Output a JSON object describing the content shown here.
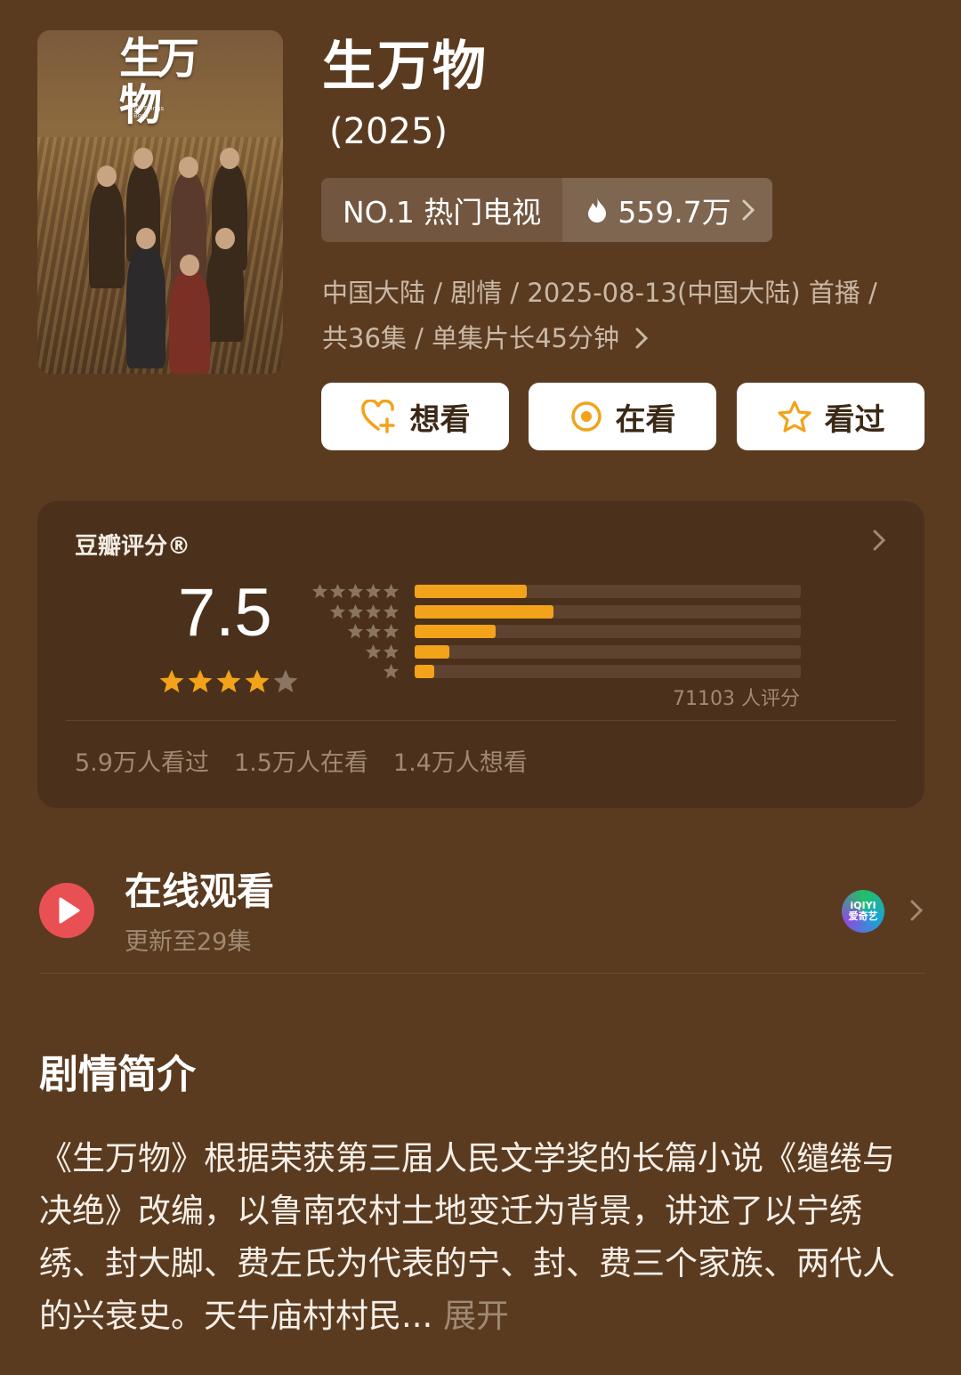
{
  "poster": {
    "logo_text": "生万物",
    "logo_sub": "All Things Born"
  },
  "title": "生万物",
  "year": "(2025)",
  "rank": {
    "label": "NO.1 热门电视",
    "heat": "559.7万"
  },
  "meta": {
    "line1": "中国大陆 / 剧情 / 2025-08-13(中国大陆) 首播 /",
    "line2": "共36集 / 单集片长45分钟"
  },
  "actions": [
    {
      "label": "想看",
      "icon": "heart-plus-icon"
    },
    {
      "label": "在看",
      "icon": "target-icon"
    },
    {
      "label": "看过",
      "icon": "star-outline-icon"
    }
  ],
  "rating": {
    "heading": "豆瓣评分®",
    "score": "7.5",
    "stars": 4,
    "distribution": [
      {
        "stars": 5,
        "fraction": 0.29
      },
      {
        "stars": 4,
        "fraction": 0.36
      },
      {
        "stars": 3,
        "fraction": 0.21
      },
      {
        "stars": 2,
        "fraction": 0.09
      },
      {
        "stars": 1,
        "fraction": 0.05
      }
    ],
    "raters": "71103 人评分",
    "counts": [
      "5.9万人看过",
      "1.5万人在看",
      "1.4万人想看"
    ]
  },
  "online": {
    "title": "在线观看",
    "subtitle": "更新至29集",
    "platform_text_top": "iQIYI",
    "platform_text_bottom": "爱奇艺"
  },
  "synopsis": {
    "title": "剧情简介",
    "text": "《生万物》根据荣获第三届人民文学奖的长篇小说《缱绻与决绝》改编，以鲁南农村土地变迁为背景，讲述了以宁绣绣、封大脚、费左氏为代表的宁、封、费三个家族、两代人的兴衰史。天牛庙村村民...",
    "expand": "展开"
  },
  "colors": {
    "background": "#5b3b20",
    "card": "#4b311b",
    "accent": "#f2a31a",
    "play": "#e95054",
    "muted": "#a08a73"
  }
}
